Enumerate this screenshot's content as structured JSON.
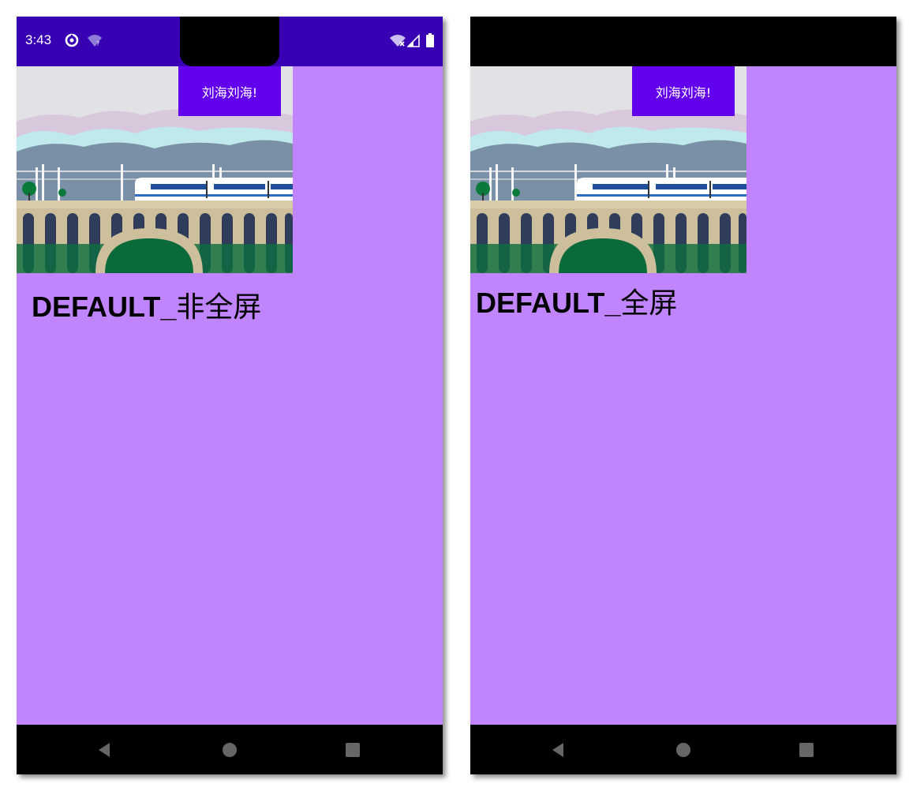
{
  "left_phone": {
    "status_time": "3:43",
    "notch_button_label": "刘海刘海!",
    "mode_label_en": "DEFAULT_",
    "mode_label_zh": "非全屏"
  },
  "right_phone": {
    "notch_button_label": "刘海刘海!",
    "mode_label_en": "DEFAULT_",
    "mode_label_zh": "全屏"
  },
  "colors": {
    "status_bar_left": "#3700b3",
    "status_bar_right": "#000000",
    "content_background": "#c084fc",
    "notch_button": "#6200ee",
    "nav_bar": "#000000"
  },
  "icons": {
    "status_left": [
      "data-saver-icon",
      "wifi-question-icon"
    ],
    "status_right": [
      "wifi-no-internet-icon",
      "cell-signal-icon",
      "battery-icon"
    ],
    "nav": [
      "back-icon",
      "home-icon",
      "recents-icon"
    ]
  }
}
